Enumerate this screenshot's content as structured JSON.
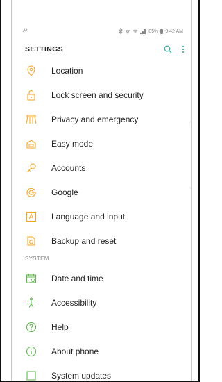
{
  "status_bar": {
    "battery": "85%",
    "time": "9:42 AM"
  },
  "header": {
    "title": "SETTINGS",
    "search_icon": "search-icon",
    "more_icon": "more-vert-icon"
  },
  "items": [
    {
      "label": "Location",
      "icon": "location-icon"
    },
    {
      "label": "Lock screen and security",
      "icon": "lock-icon"
    },
    {
      "label": "Privacy and emergency",
      "icon": "privacy-icon"
    },
    {
      "label": "Easy mode",
      "icon": "easy-mode-icon"
    },
    {
      "label": "Accounts",
      "icon": "key-icon"
    },
    {
      "label": "Google",
      "icon": "google-icon"
    },
    {
      "label": "Language and input",
      "icon": "language-icon"
    },
    {
      "label": "Backup and reset",
      "icon": "backup-icon"
    }
  ],
  "section_system": "SYSTEM",
  "system_items": [
    {
      "label": "Date and time",
      "icon": "calendar-clock-icon"
    },
    {
      "label": "Accessibility",
      "icon": "accessibility-icon"
    },
    {
      "label": "Help",
      "icon": "help-icon"
    },
    {
      "label": "About phone",
      "icon": "info-icon"
    },
    {
      "label": "System updates",
      "icon": "system-update-icon"
    }
  ],
  "colors": {
    "orange": "#f5a623",
    "green": "#5fb94c",
    "teal": "#3bb3a3"
  }
}
